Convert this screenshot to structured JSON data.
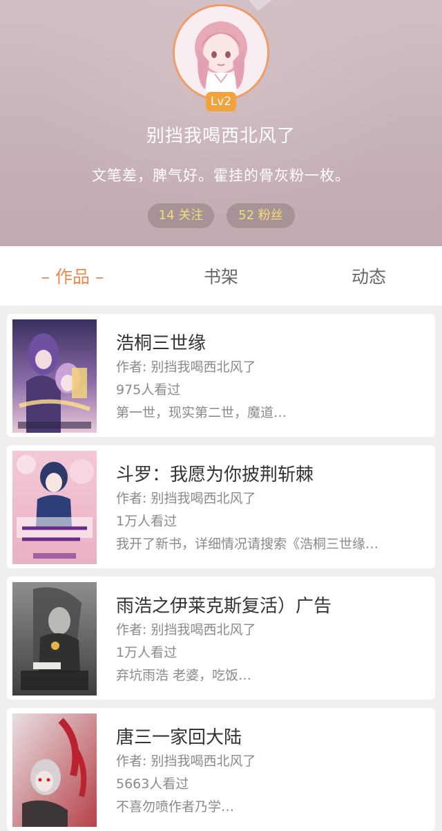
{
  "profile": {
    "level": "Lv2",
    "username": "别挡我喝西北风了",
    "bio": "文笔差，脾气好。霍挂的骨灰粉一枚。",
    "follow_label": "14 关注",
    "fans_label": "52 粉丝"
  },
  "tabs": {
    "works": "– 作品 –",
    "bookshelf": "书架",
    "moments": "动态"
  },
  "books": [
    {
      "title": "浩桐三世缘",
      "author": "作者: 别挡我喝西北风了",
      "views": "975人看过",
      "desc": "第一世，现实第二世，魔道…"
    },
    {
      "title": "斗罗：我愿为你披荆斩棘",
      "author": "作者: 别挡我喝西北风了",
      "views": "1万人看过",
      "desc": "我开了新书，详细情况请搜索《浩桐三世缘…"
    },
    {
      "title": "雨浩之伊莱克斯复活）广告",
      "author": "作者: 别挡我喝西北风了",
      "views": "1万人看过",
      "desc": "弃坑雨浩 老婆，吃饭…"
    },
    {
      "title": "唐三一家回大陆",
      "author": "作者: 别挡我喝西北风了",
      "views": "5663人看过",
      "desc": "不喜勿喷作者乃学…"
    }
  ],
  "colors": {
    "accent": "#f0874a",
    "level_badge": "#f2a23a",
    "pill_text": "#f5dc7a"
  }
}
